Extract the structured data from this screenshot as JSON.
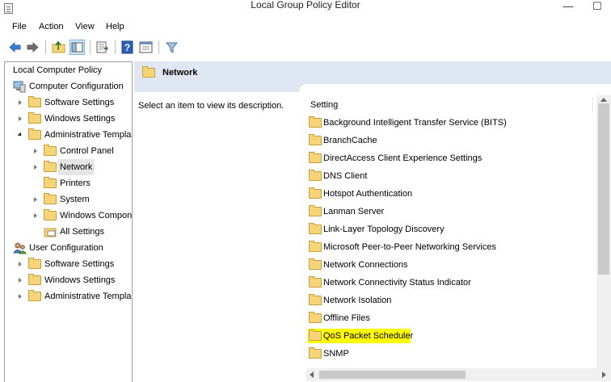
{
  "window": {
    "title": "Local Group Policy Editor",
    "minimize": "—",
    "restore": "☐"
  },
  "menu": {
    "file": "File",
    "action": "Action",
    "view": "View",
    "help": "Help"
  },
  "tree": {
    "root": "Local Computer Policy",
    "computer_config": "Computer Configuration",
    "cc_software": "Software Settings",
    "cc_windows": "Windows Settings",
    "cc_admin": "Administrative Templa",
    "control_panel": "Control Panel",
    "network": "Network",
    "printers": "Printers",
    "system": "System",
    "windows_components": "Windows Compone",
    "all_settings": "All Settings",
    "user_config": "User Configuration",
    "uc_software": "Software Settings",
    "uc_windows": "Windows Settings",
    "uc_admin": "Administrative Templa"
  },
  "right": {
    "banner_title": "Network",
    "description": "Select an item to view its description.",
    "column_header": "Setting",
    "items": [
      "Background Intelligent Transfer Service (BITS)",
      "BranchCache",
      "DirectAccess Client Experience Settings",
      "DNS Client",
      "Hotspot Authentication",
      "Lanman Server",
      "Link-Layer Topology Discovery",
      "Microsoft Peer-to-Peer Networking Services",
      "Network Connections",
      "Network Connectivity Status Indicator",
      "Network Isolation",
      "Offline Files",
      "QoS Packet Scheduler",
      "SNMP"
    ]
  },
  "colors": {
    "highlight": "#fffb00",
    "banner": "#dfe7f2",
    "folder": "#f6d57a"
  }
}
